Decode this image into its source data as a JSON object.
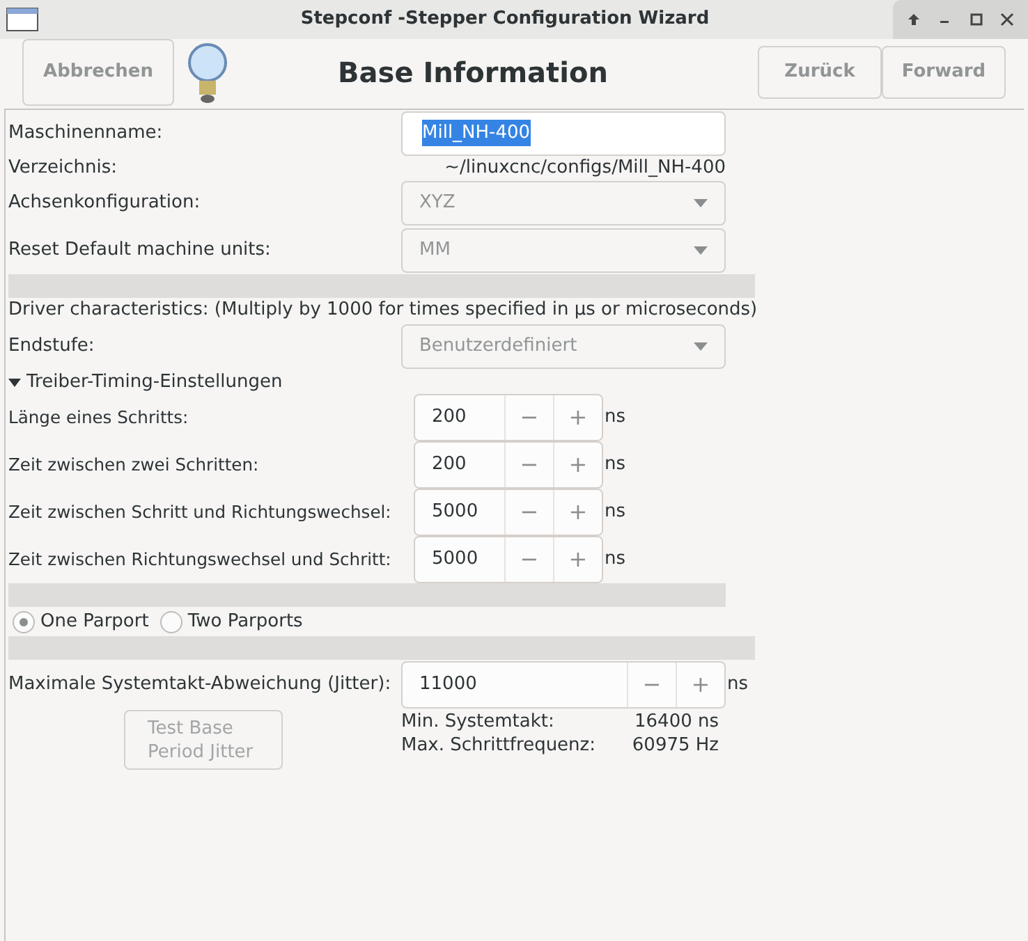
{
  "window": {
    "title": "Stepconf -Stepper Configuration Wizard"
  },
  "header": {
    "cancel": "Abbrechen",
    "title": "Base Information",
    "back": "Zurück",
    "forward": "Forward"
  },
  "machine_name": {
    "label": "Maschinenname:",
    "value": "Mill_NH-400"
  },
  "directory": {
    "label": "Verzeichnis:",
    "value": "~/linuxcnc/configs/Mill_NH-400"
  },
  "axis_config": {
    "label": "Achsenkonfiguration:",
    "value": "XYZ",
    "disabled": true
  },
  "units": {
    "label": "Reset Default machine units:",
    "value": "MM",
    "disabled": true
  },
  "driver_note": "Driver characteristics: (Multiply by 1000 for times specified in µs or microseconds)",
  "driver": {
    "label": "Endstufe:",
    "value": "Benutzerdefiniert",
    "disabled": true
  },
  "timing": {
    "label": "Treiber-Timing-Einstellungen",
    "expanded": true,
    "rows": [
      {
        "label": "Länge eines Schritts:",
        "value": "200",
        "minus": "−",
        "plus": "+",
        "unit": "ns"
      },
      {
        "label": "Zeit zwischen zwei Schritten:",
        "value": "200",
        "minus": "−",
        "plus": "+",
        "unit": "ns"
      },
      {
        "label": "Zeit zwischen Schritt und Richtungswechsel:",
        "value": "5000",
        "minus": "−",
        "plus": "+",
        "unit": "ns"
      },
      {
        "label": "Zeit zwischen Richtungswechsel und Schritt:",
        "value": "5000",
        "minus": "−",
        "plus": "+",
        "unit": "ns"
      }
    ]
  },
  "parports": [
    {
      "label": "One Parport",
      "selected": true
    },
    {
      "label": "Two Parports",
      "selected": false
    }
  ],
  "jitter": {
    "label": "Maximale Systemtakt-Abweichung (Jitter):",
    "value": "11000",
    "minus": "−",
    "plus": "+",
    "unit": "ns"
  },
  "test_button": {
    "label": "Test Base Period Jitter",
    "disabled": true
  },
  "stats": [
    {
      "label": "Min. Systemtakt:",
      "value": "16400 ns"
    },
    {
      "label": "Max. Schrittfrequenz:",
      "value": "60975 Hz"
    }
  ]
}
